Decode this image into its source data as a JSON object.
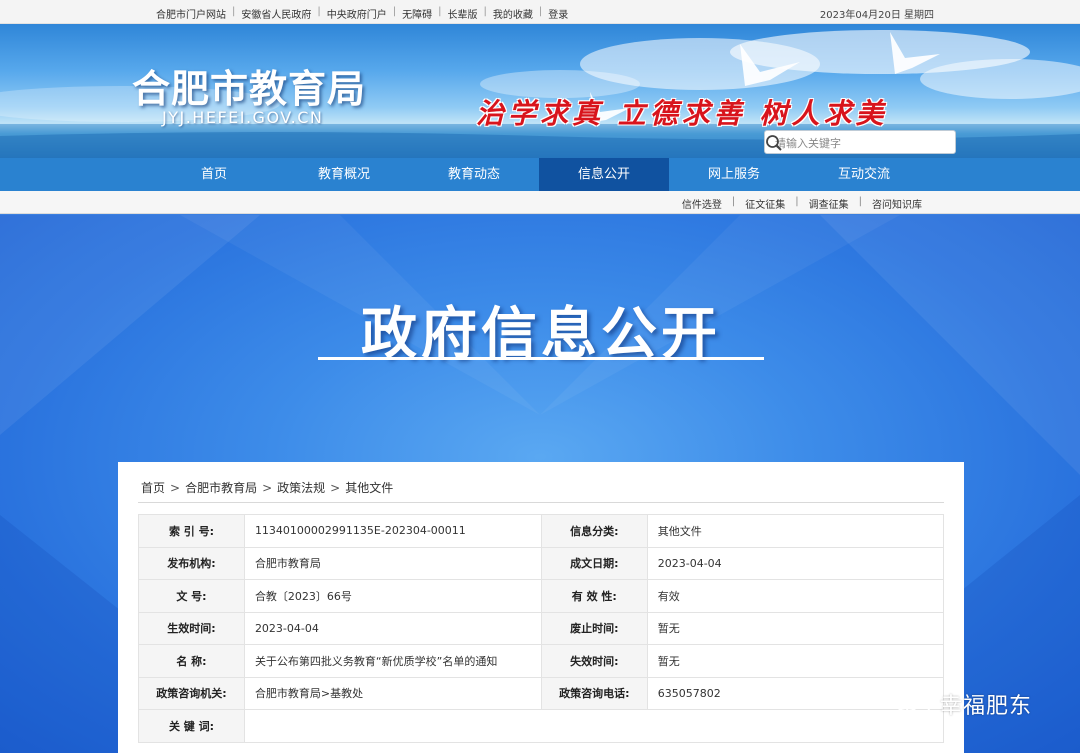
{
  "topbar": {
    "links": [
      "合肥市门户网站",
      "安徽省人民政府",
      "中央政府门户",
      "无障碍",
      "长辈版",
      "我的收藏",
      "登录"
    ],
    "date": "2023年04月20日 星期四"
  },
  "banner": {
    "site_name": "合肥市教育局",
    "site_url": "JYJ.HEFEI.GOV.CN",
    "motto": "治学求真 立德求善 树人求美",
    "search_placeholder": "请输入关键字"
  },
  "nav": {
    "items": [
      "首页",
      "教育概况",
      "教育动态",
      "信息公开",
      "网上服务",
      "互动交流"
    ],
    "active_index": 3
  },
  "subnav": {
    "items": [
      "信件选登",
      "征文征集",
      "调查征集",
      "咨问知识库"
    ]
  },
  "hero": {
    "title": "政府信息公开"
  },
  "breadcrumb": {
    "items": [
      "首页",
      "合肥市教育局",
      "政策法规",
      "其他文件"
    ]
  },
  "meta": {
    "index_no_label": "索 引 号:",
    "index_no": "11340100002991135E-202304-00011",
    "category_label": "信息分类:",
    "category": "其他文件",
    "publisher_label": "发布机构:",
    "publisher": "合肥市教育局",
    "created_label": "成文日期:",
    "created": "2023-04-04",
    "doc_no_label": "文 号:",
    "doc_no": "合教〔2023〕66号",
    "validity_label": "有 效 性:",
    "validity": "有效",
    "effective_label": "生效时间:",
    "effective": "2023-04-04",
    "repealed_label": "废止时间:",
    "repealed": "暂无",
    "name_label": "名 称:",
    "name": "关于公布第四批义务教育“新优质学校”名单的通知",
    "expire_label": "失效时间:",
    "expire": "暂无",
    "consult_org_label": "政策咨询机关:",
    "consult_org": "合肥市教育局>基教处",
    "consult_phone_label": "政策咨询电话:",
    "consult_phone": "635057802",
    "keywords_label": "关 键 词:",
    "keywords": ""
  },
  "watermark": {
    "text": "幸福肥东",
    "icon": "wechat-icon"
  },
  "colors": {
    "nav_bg": "#2a82d0",
    "nav_active": "#1052a0",
    "hero_blue": "#2a73de",
    "motto_red": "#d8141c"
  }
}
